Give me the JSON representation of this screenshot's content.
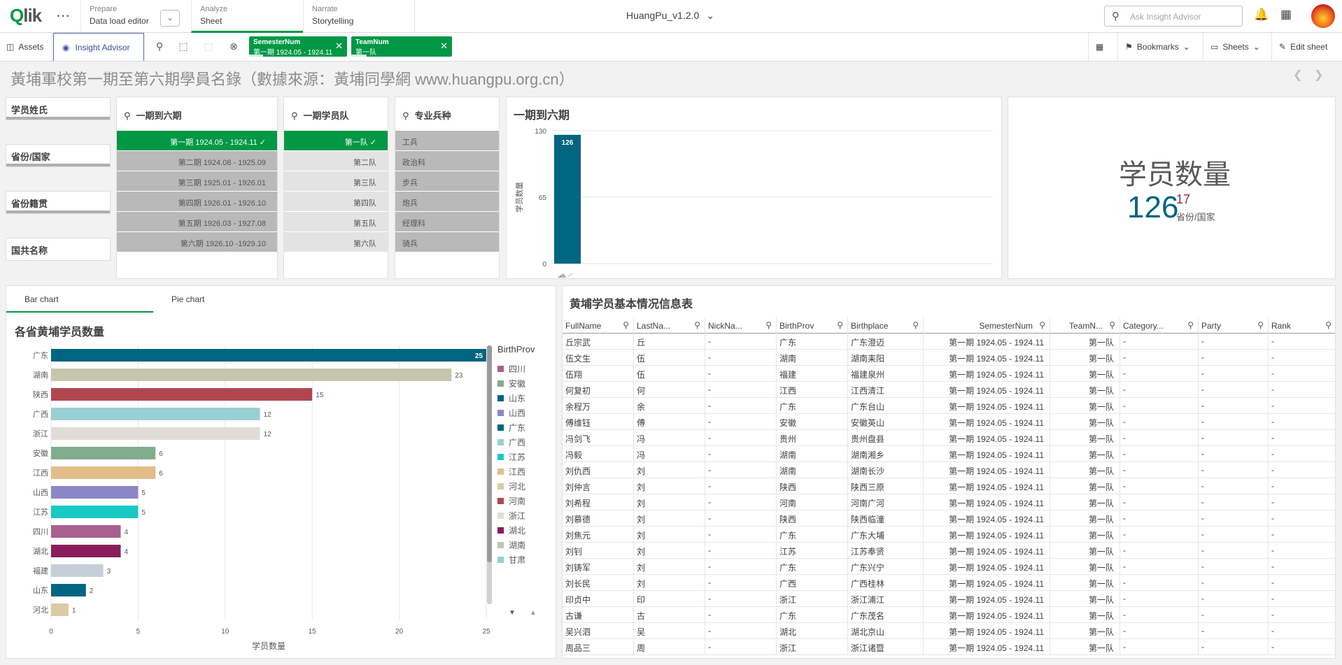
{
  "app": {
    "title": "HuangPu_v1.2.0"
  },
  "nav": {
    "prepare": {
      "small": "Prepare",
      "label": "Data load editor"
    },
    "analyze": {
      "small": "Analyze",
      "label": "Sheet"
    },
    "narrate": {
      "small": "Narrate",
      "label": "Storytelling"
    }
  },
  "search": {
    "placeholder": "Ask Insight Advisor"
  },
  "toolbar": {
    "assets": "Assets",
    "insight_advisor": "Insight Advisor",
    "chips": [
      {
        "field": "SemesterNum",
        "value": "第一期 1924.05 - 1924.11"
      },
      {
        "field": "TeamNum",
        "value": "第一队"
      }
    ],
    "bookmarks": "Bookmarks",
    "sheets": "Sheets",
    "edit": "Edit sheet"
  },
  "sheet_title": "黃埔軍校第一期至第六期學員名錄（數據來源：黃埔同學網 www.huangpu.org.cn）",
  "filters": [
    "学员姓氏",
    "省份/国家",
    "省份籍贯",
    "国共名称"
  ],
  "listbox_semester": {
    "title": "一期到六期",
    "items": [
      {
        "label": "第一期 1924.05 - 1924.11",
        "selected": true
      },
      {
        "label": "第二期 1924.08 - 1925.09",
        "selected": false
      },
      {
        "label": "第三期 1925.01 - 1926.01",
        "selected": false
      },
      {
        "label": "第四期 1926.01 - 1926.10",
        "selected": false
      },
      {
        "label": "第五期 1926.03 - 1927.08",
        "selected": false
      },
      {
        "label": "第六期 1926.10 -1929.10",
        "selected": false
      }
    ]
  },
  "listbox_team": {
    "title": "一期学员队",
    "items": [
      {
        "label": "第一队",
        "selected": true
      },
      {
        "label": "第二队",
        "selected": false
      },
      {
        "label": "第三队",
        "selected": false
      },
      {
        "label": "第四队",
        "selected": false
      },
      {
        "label": "第五队",
        "selected": false
      },
      {
        "label": "第六队",
        "selected": false
      }
    ]
  },
  "listbox_branch": {
    "title": "专业兵种",
    "items": [
      "工兵",
      "政治科",
      "步兵",
      "炮兵",
      "经理科",
      "骑兵"
    ]
  },
  "kpi": {
    "title": "学员数量",
    "value": "126",
    "sub_value": "17",
    "sub_label": "省份/国家"
  },
  "chart_tabs": [
    "Bar chart",
    "Pie chart"
  ],
  "chart_data": [
    {
      "type": "bar",
      "title": "一期到六期",
      "ylabel": "学员数量",
      "categories": [
        "第一期 ..."
      ],
      "values": [
        126
      ],
      "yticks": [
        0,
        65,
        130
      ],
      "ylim": [
        0,
        130
      ]
    },
    {
      "type": "bar",
      "orientation": "horizontal",
      "title": "各省黄埔学员数量",
      "xlabel": "学员数量",
      "legend_title": "BirthProv",
      "categories": [
        "广东",
        "湖南",
        "陕西",
        "广西",
        "浙江",
        "安徽",
        "江西",
        "山西",
        "江苏",
        "四川",
        "湖北",
        "福建",
        "山东",
        "河北"
      ],
      "values": [
        25,
        23,
        15,
        12,
        12,
        6,
        6,
        5,
        5,
        4,
        4,
        3,
        2,
        1
      ],
      "colors": [
        "#006580",
        "#c6c6ad",
        "#b0464f",
        "#99d0d4",
        "#e0dcd8",
        "#7fad8e",
        "#e2bd8a",
        "#8b86c6",
        "#18c9c4",
        "#a8608f",
        "#8a1d5c",
        "#c5ced9",
        "#006580",
        "#d9cba5"
      ],
      "xticks": [
        0,
        5,
        10,
        15,
        20,
        25
      ],
      "xlim": [
        0,
        25
      ],
      "legend": [
        {
          "name": "四川",
          "color": "#a8608f"
        },
        {
          "name": "安徽",
          "color": "#7fad8e"
        },
        {
          "name": "山东",
          "color": "#006580"
        },
        {
          "name": "山西",
          "color": "#8b86c6"
        },
        {
          "name": "广东",
          "color": "#006580"
        },
        {
          "name": "广西",
          "color": "#99d0d4"
        },
        {
          "name": "江苏",
          "color": "#18c9c4"
        },
        {
          "name": "江西",
          "color": "#e2bd8a"
        },
        {
          "name": "河北",
          "color": "#d9cba5"
        },
        {
          "name": "河南",
          "color": "#b0464f"
        },
        {
          "name": "浙江",
          "color": "#e0dcd8"
        },
        {
          "name": "湖北",
          "color": "#8a1d5c"
        },
        {
          "name": "湖南",
          "color": "#c6c6ad"
        },
        {
          "name": "甘肃",
          "color": "#99d0d4"
        }
      ]
    }
  ],
  "table": {
    "title": "黄埔学员基本情况信息表",
    "columns": [
      "FullName",
      "LastNa...",
      "NickNa...",
      "BirthProv",
      "Birthplace",
      "SemesterNum",
      "TeamN...",
      "Category...",
      "Party",
      "Rank"
    ],
    "rows": [
      [
        "丘宗武",
        "丘",
        "-",
        "广东",
        "广东澄迈",
        "第一期 1924.05 - 1924.11",
        "第一队",
        "-",
        "-",
        "-"
      ],
      [
        "伍文生",
        "伍",
        "-",
        "湖南",
        "湖南耒阳",
        "第一期 1924.05 - 1924.11",
        "第一队",
        "-",
        "-",
        "-"
      ],
      [
        "伍翔",
        "伍",
        "-",
        "福建",
        "福建泉州",
        "第一期 1924.05 - 1924.11",
        "第一队",
        "-",
        "-",
        "-"
      ],
      [
        "何复初",
        "何",
        "-",
        "江西",
        "江西清江",
        "第一期 1924.05 - 1924.11",
        "第一队",
        "-",
        "-",
        "-"
      ],
      [
        "余程万",
        "余",
        "-",
        "广东",
        "广东台山",
        "第一期 1924.05 - 1924.11",
        "第一队",
        "-",
        "-",
        "-"
      ],
      [
        "傅维钰",
        "傅",
        "-",
        "安徽",
        "安徽英山",
        "第一期 1924.05 - 1924.11",
        "第一队",
        "-",
        "-",
        "-"
      ],
      [
        "冯剑飞",
        "冯",
        "-",
        "贵州",
        "贵州盘县",
        "第一期 1924.05 - 1924.11",
        "第一队",
        "-",
        "-",
        "-"
      ],
      [
        "冯毅",
        "冯",
        "-",
        "湖南",
        "湖南湘乡",
        "第一期 1924.05 - 1924.11",
        "第一队",
        "-",
        "-",
        "-"
      ],
      [
        "刘仇西",
        "刘",
        "-",
        "湖南",
        "湖南长沙",
        "第一期 1924.05 - 1924.11",
        "第一队",
        "-",
        "-",
        "-"
      ],
      [
        "刘仲言",
        "刘",
        "-",
        "陕西",
        "陕西三原",
        "第一期 1924.05 - 1924.11",
        "第一队",
        "-",
        "-",
        "-"
      ],
      [
        "刘希程",
        "刘",
        "-",
        "河南",
        "河南广河",
        "第一期 1924.05 - 1924.11",
        "第一队",
        "-",
        "-",
        "-"
      ],
      [
        "刘慕德",
        "刘",
        "-",
        "陕西",
        "陕西临潼",
        "第一期 1924.05 - 1924.11",
        "第一队",
        "-",
        "-",
        "-"
      ],
      [
        "刘焦元",
        "刘",
        "-",
        "广东",
        "广东大埔",
        "第一期 1924.05 - 1924.11",
        "第一队",
        "-",
        "-",
        "-"
      ],
      [
        "刘钊",
        "刘",
        "-",
        "江苏",
        "江苏奉贤",
        "第一期 1924.05 - 1924.11",
        "第一队",
        "-",
        "-",
        "-"
      ],
      [
        "刘铸军",
        "刘",
        "-",
        "广东",
        "广东兴宁",
        "第一期 1924.05 - 1924.11",
        "第一队",
        "-",
        "-",
        "-"
      ],
      [
        "刘长民",
        "刘",
        "-",
        "广西",
        "广西桂林",
        "第一期 1924.05 - 1924.11",
        "第一队",
        "-",
        "-",
        "-"
      ],
      [
        "印贞中",
        "印",
        "-",
        "浙江",
        "浙江浦江",
        "第一期 1924.05 - 1924.11",
        "第一队",
        "-",
        "-",
        "-"
      ],
      [
        "古谦",
        "古",
        "-",
        "广东",
        "广东茂名",
        "第一期 1924.05 - 1924.11",
        "第一队",
        "-",
        "-",
        "-"
      ],
      [
        "吴兴泗",
        "吴",
        "-",
        "湖北",
        "湖北京山",
        "第一期 1924.05 - 1924.11",
        "第一队",
        "-",
        "-",
        "-"
      ],
      [
        "周品三",
        "周",
        "-",
        "浙江",
        "浙江诸暨",
        "第一期 1924.05 - 1924.11",
        "第一队",
        "-",
        "-",
        "-"
      ]
    ]
  }
}
